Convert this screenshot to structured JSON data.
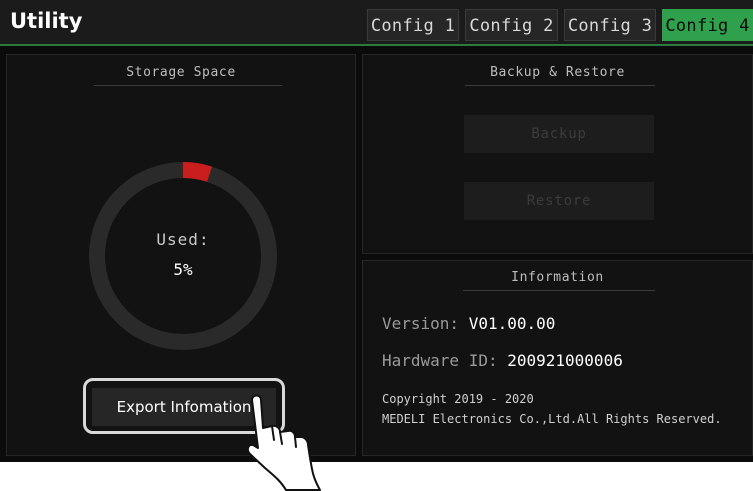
{
  "header": {
    "title": "Utility",
    "tabs": [
      {
        "label": "Config 1",
        "active": false
      },
      {
        "label": "Config 2",
        "active": false
      },
      {
        "label": "Config 3",
        "active": false
      },
      {
        "label": "Config 4",
        "active": true
      }
    ]
  },
  "storage": {
    "title": "Storage Space",
    "used_label": "Used:",
    "used_value": "5%",
    "used_fraction": 0.05,
    "export_label": "Export Infomation"
  },
  "backup": {
    "title": "Backup & Restore",
    "backup_label": "Backup",
    "restore_label": "Restore"
  },
  "info": {
    "title": "Information",
    "version_label": "Version: ",
    "version_value": "V01.00.00",
    "hardware_label": "Hardware ID: ",
    "hardware_value": "200921000006",
    "copyright": "Copyright 2019 - 2020",
    "rights": "MEDELI Electronics Co.,Ltd.All Rights Reserved."
  },
  "colors": {
    "accent": "#2fa14d",
    "ring_used": "#c81e1e",
    "ring_track": "#2a2a2a"
  },
  "icons": {
    "pointer": "hand-pointer-icon"
  }
}
